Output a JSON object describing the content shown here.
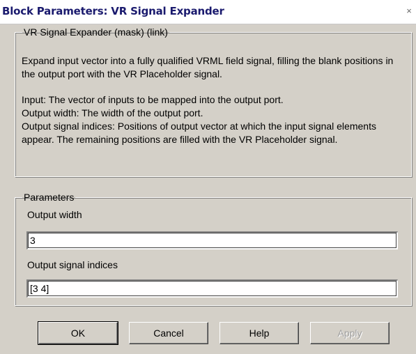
{
  "window": {
    "title": "Block Parameters: VR Signal Expander",
    "close_glyph": "×"
  },
  "mask": {
    "legend": "VR Signal Expander (mask) (link)",
    "description": [
      "Expand input vector into a fully qualified VRML field signal, filling the blank positions in the output port with the VR Placeholder signal.",
      "Input: The vector of inputs to be mapped into the output port.\nOutput width: The width of the output port.\nOutput signal indices: Positions of output vector at which the input signal elements appear. The remaining positions are filled with the VR Placeholder signal."
    ]
  },
  "parameters": {
    "legend": "Parameters",
    "output_width_label": "Output width",
    "output_width_value": "3",
    "output_indices_label": "Output signal indices",
    "output_indices_value": "[3 4]"
  },
  "buttons": {
    "ok": "OK",
    "cancel": "Cancel",
    "help": "Help",
    "apply": "Apply"
  },
  "icons": {
    "close": "close-icon"
  }
}
